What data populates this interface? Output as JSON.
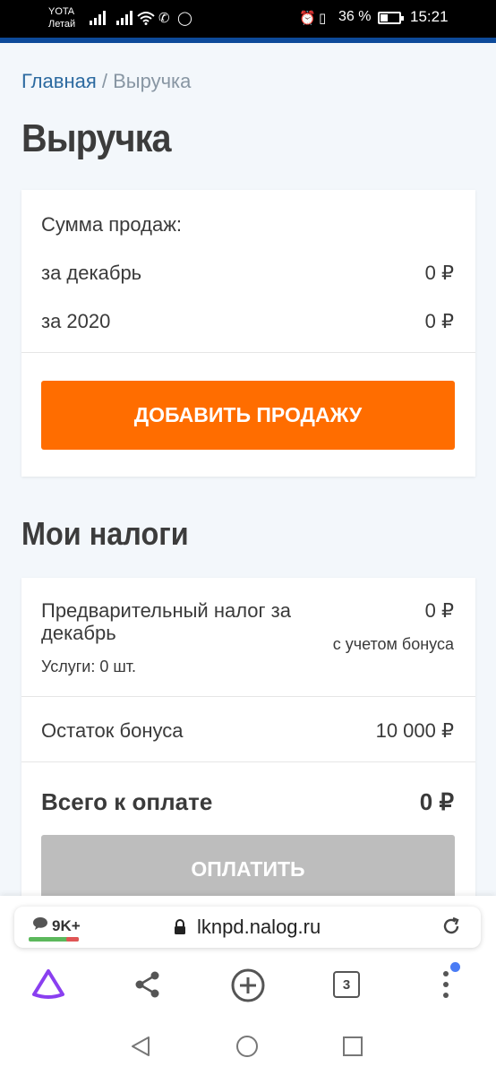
{
  "status_bar": {
    "carrier_1": "YOTA",
    "carrier_2": "Летай",
    "battery_pct": "36 %",
    "time": "15:21"
  },
  "breadcrumb": {
    "home": "Главная",
    "separator": "/",
    "current": "Выручка"
  },
  "page_title": "Выручка",
  "sales_card": {
    "heading": "Сумма продаж:",
    "rows": [
      {
        "label": "за декабрь",
        "value": "0 ₽"
      },
      {
        "label": "за 2020",
        "value": "0 ₽"
      }
    ],
    "add_button": "ДОБАВИТЬ ПРОДАЖУ"
  },
  "taxes_title": "Мои налоги",
  "taxes_card": {
    "prelim_label": "Предварительный налог за декабрь",
    "prelim_value": "0 ₽",
    "prelim_note": "с учетом бонуса",
    "services": "Услуги: 0 шт.",
    "bonus_label": "Остаток бонуса",
    "bonus_value": "10 000 ₽",
    "total_label": "Всего к оплате",
    "total_value": "0 ₽",
    "pay_button": "ОПЛАТИТЬ"
  },
  "browser": {
    "badge": "9K+",
    "url": "lknpd.nalog.ru",
    "tabs_count": "3"
  },
  "colors": {
    "accent_orange": "#ff6d00",
    "link_blue": "#2c6aa0",
    "top_stripe": "#0d4a9a",
    "disabled_gray": "#bdbdbd"
  }
}
